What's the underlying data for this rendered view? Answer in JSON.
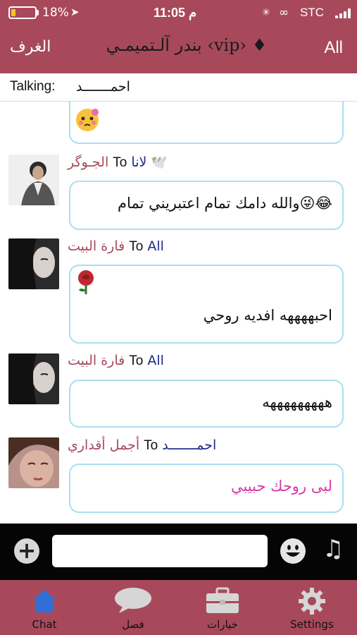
{
  "status_bar": {
    "battery_percent": "18%",
    "battery_level": 0.18,
    "time": "11:05 م",
    "carrier": "STC",
    "colors": {
      "bar_bg": "#a8495b",
      "battery_fill": "#f5c518"
    }
  },
  "nav": {
    "left_label": "الغرف",
    "title": "بندر آلـتميمـي ‹vip› ♦",
    "right_label": "All"
  },
  "talking": {
    "label": "Talking:",
    "name": "احمـــــــد"
  },
  "messages": [
    {
      "partial": true,
      "emoji_icon": "blushing-face-icon"
    },
    {
      "sender": "لانا 🕊️",
      "to": "To",
      "recipient": "الجـوگر",
      "text": "والله دامك تمام اعتبريني تمام😜😂",
      "avatar_icon": "man-portrait-avatar"
    },
    {
      "sender": "All",
      "to": "To",
      "recipient": "فارة البيت",
      "text": "احبههههه افديه روحي",
      "attachment_icon": "rose-icon",
      "avatar_icon": "woman-portrait-avatar"
    },
    {
      "sender": "All",
      "to": "To",
      "recipient": "فارة البيت",
      "text": "هههههههههه",
      "avatar_icon": "woman-portrait-avatar"
    },
    {
      "sender": "احمـــــــد",
      "to": "To",
      "recipient": "أجمل أقداري",
      "text": "لبى روحك حبيبي",
      "text_color": "#d63aa6",
      "avatar_icon": "woman-closeup-avatar"
    }
  ],
  "input_bar": {
    "placeholder": ""
  },
  "tabs": [
    {
      "label": "Chat",
      "icon": "house-icon",
      "active": true
    },
    {
      "label": "فصل",
      "icon": "speech-bubble-icon",
      "active": false
    },
    {
      "label": "خيارات",
      "icon": "toolbox-icon",
      "active": false
    },
    {
      "label": "Settings",
      "icon": "gear-icon",
      "active": false
    }
  ],
  "colors": {
    "accent": "#a8495b",
    "bubble_border": "#a9dff0",
    "sender_blue": "#1e2a8a",
    "active_tab": "#2f6fd6"
  }
}
